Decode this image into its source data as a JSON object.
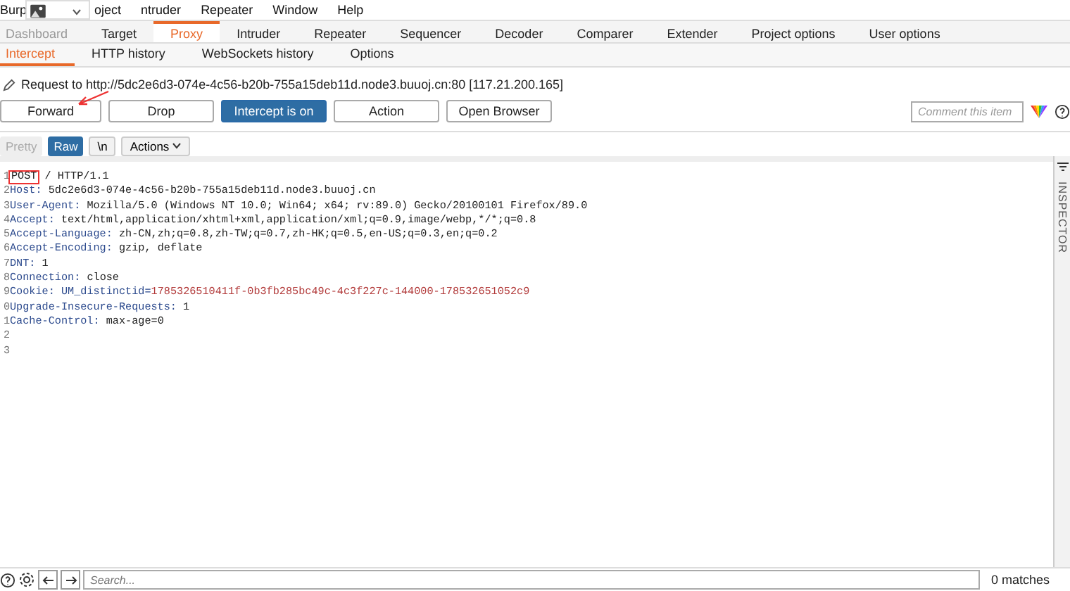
{
  "menu": [
    "Burp",
    "oject",
    "ntruder",
    "Repeater",
    "Window",
    "Help"
  ],
  "tabs": [
    {
      "label": "Dashboard",
      "selected": false
    },
    {
      "label": "Target",
      "selected": false
    },
    {
      "label": "Proxy",
      "selected": true
    },
    {
      "label": "Intruder",
      "selected": false
    },
    {
      "label": "Repeater",
      "selected": false
    },
    {
      "label": "Sequencer",
      "selected": false
    },
    {
      "label": "Decoder",
      "selected": false
    },
    {
      "label": "Comparer",
      "selected": false
    },
    {
      "label": "Extender",
      "selected": false
    },
    {
      "label": "Project options",
      "selected": false
    },
    {
      "label": "User options",
      "selected": false
    }
  ],
  "subtabs": [
    {
      "label": "Intercept",
      "selected": true
    },
    {
      "label": "HTTP history",
      "selected": false
    },
    {
      "label": "WebSockets history",
      "selected": false
    },
    {
      "label": "Options",
      "selected": false
    }
  ],
  "request_info": "Request to http://5dc2e6d3-074e-4c56-b20b-755a15deb11d.node3.buuoj.cn:80  [117.21.200.165]",
  "buttons": [
    {
      "label": "Forward",
      "on": false
    },
    {
      "label": "Drop",
      "on": false
    },
    {
      "label": "Intercept is on",
      "on": true
    },
    {
      "label": "Action",
      "on": false
    },
    {
      "label": "Open Browser",
      "on": false
    }
  ],
  "comment": {
    "placeholder": "Comment this item"
  },
  "view_tabs": [
    {
      "label": "Pretty",
      "selected": false,
      "disabled": true
    },
    {
      "label": "Raw",
      "selected": true,
      "disabled": false
    }
  ],
  "newline_toggle": "\\n",
  "actions_menu": "Actions",
  "lines": [
    {
      "number": "1",
      "kind": "request",
      "method": "POST",
      "rest": " / HTTP/1.1",
      "highlighted": true
    },
    {
      "number": "2",
      "kind": "header",
      "name": "Host:",
      "value": "5dc2e6d3-074e-4c56-b20b-755a15deb11d.node3.buuoj.cn"
    },
    {
      "number": "3",
      "kind": "header",
      "name": "User-Agent:",
      "value": "Mozilla/5.0 (Windows NT 10.0; Win64; x64; rv:89.0) Gecko/20100101 Firefox/89.0"
    },
    {
      "number": "4",
      "kind": "header",
      "name": "Accept:",
      "value": "text/html,application/xhtml+xml,application/xml;q=0.9,image/webp,*/*;q=0.8"
    },
    {
      "number": "5",
      "kind": "header",
      "name": "Accept-Language:",
      "value": "zh-CN,zh;q=0.8,zh-TW;q=0.7,zh-HK;q=0.5,en-US;q=0.3,en;q=0.2"
    },
    {
      "number": "6",
      "kind": "header",
      "name": "Accept-Encoding:",
      "value": "gzip, deflate"
    },
    {
      "number": "7",
      "kind": "header",
      "name": "DNT:",
      "value": "1"
    },
    {
      "number": "8",
      "kind": "header",
      "name": "Connection:",
      "value": "close"
    },
    {
      "number": "9",
      "kind": "cookie",
      "name": "Cookie:",
      "param": "UM_distinctid=",
      "value": "1785326510411f-0b3fb285bc49c-4c3f227c-144000-178532651052c9"
    },
    {
      "number": "0",
      "kind": "header",
      "name": "Upgrade-Insecure-Requests:",
      "value": "1"
    },
    {
      "number": "1",
      "kind": "header",
      "name": "Cache-Control:",
      "value": "max-age=0"
    },
    {
      "number": "2",
      "kind": "blank"
    },
    {
      "number": "3",
      "kind": "blank"
    }
  ],
  "inspector": "INSPECTOR",
  "search": {
    "placeholder": "Search..."
  },
  "matches": "0 matches"
}
